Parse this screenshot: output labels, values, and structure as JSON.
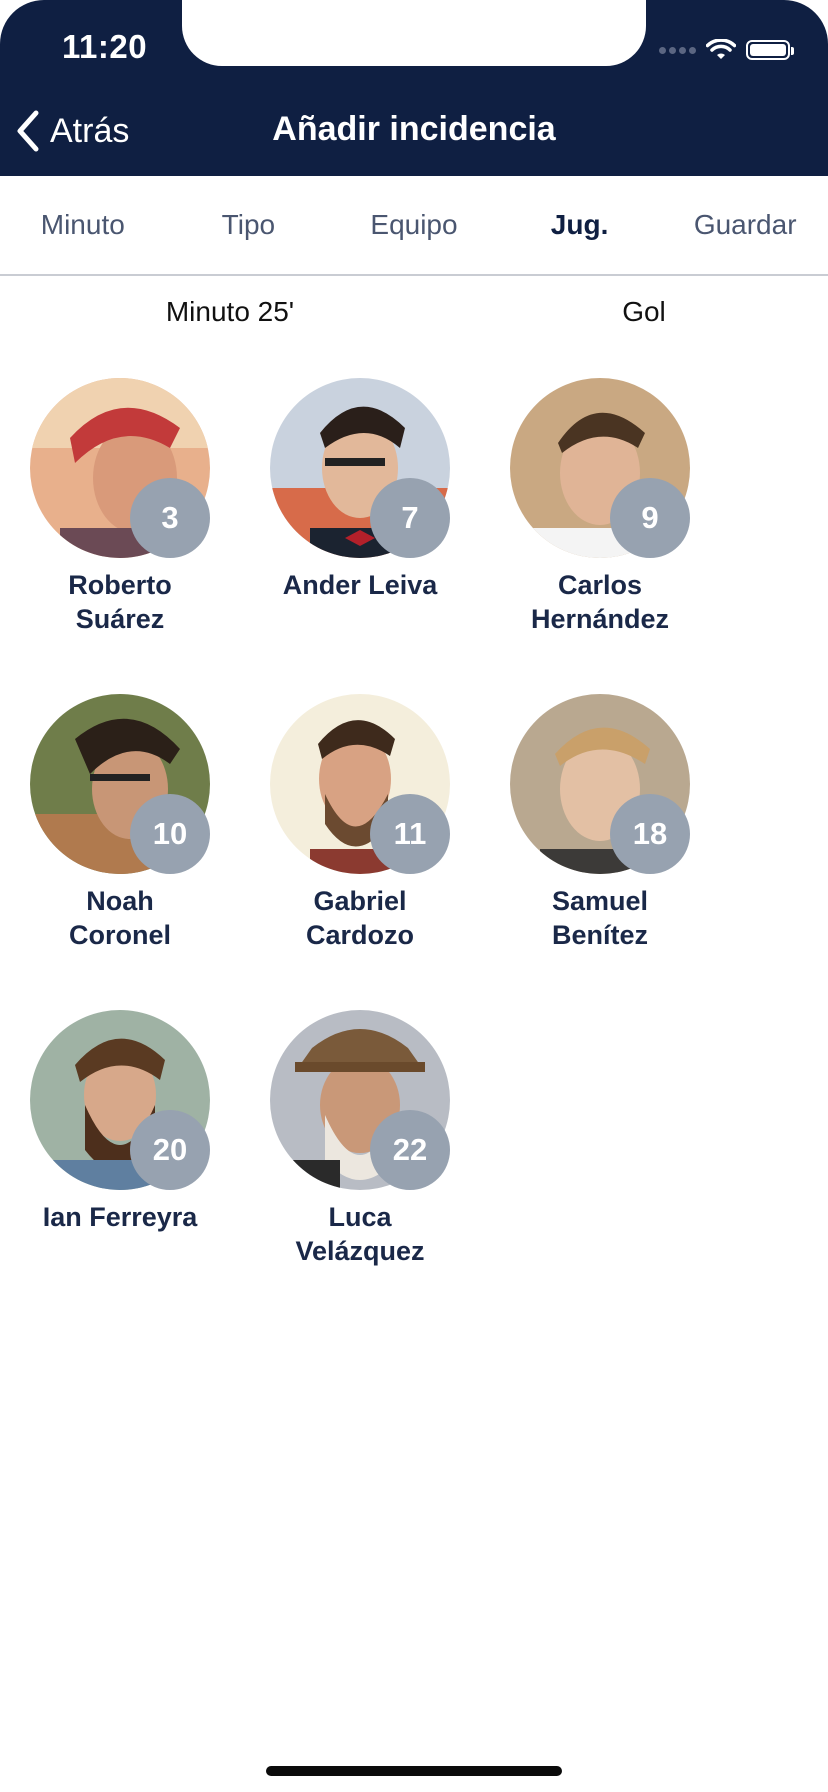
{
  "status": {
    "time": "11:20"
  },
  "nav": {
    "back_label": "Atrás",
    "title": "Añadir incidencia"
  },
  "tabs": [
    {
      "label": "Minuto",
      "active": false
    },
    {
      "label": "Tipo",
      "active": false
    },
    {
      "label": "Equipo",
      "active": false
    },
    {
      "label": "Jug.",
      "active": true
    },
    {
      "label": "Guardar",
      "active": false
    }
  ],
  "summary": {
    "minute": "Minuto 25'",
    "type": "Gol"
  },
  "players": [
    {
      "number": "3",
      "name": "Roberto Suárez",
      "line1": "Roberto",
      "line2": "Suárez",
      "avatar": "person-photo-red-cap"
    },
    {
      "number": "7",
      "name": "Ander Leiva",
      "line1": "Ander Leiva",
      "line2": "",
      "avatar": "person-photo-glasses-bowtie"
    },
    {
      "number": "9",
      "name": "Carlos Hernández",
      "line1": "Carlos",
      "line2": "Hernández",
      "avatar": "person-photo-young"
    },
    {
      "number": "10",
      "name": "Noah Coronel",
      "line1": "Noah",
      "line2": "Coronel",
      "avatar": "person-photo-pipe"
    },
    {
      "number": "11",
      "name": "Gabriel Cardozo",
      "line1": "Gabriel",
      "line2": "Cardozo",
      "avatar": "person-photo-beard"
    },
    {
      "number": "18",
      "name": "Samuel Benítez",
      "line1": "Samuel",
      "line2": "Benítez",
      "avatar": "person-photo-blond"
    },
    {
      "number": "20",
      "name": "Ian Ferreyra",
      "line1": "Ian Ferreyra",
      "line2": "",
      "avatar": "person-photo-long-beard"
    },
    {
      "number": "22",
      "name": "Luca Velázquez",
      "line1": "Luca",
      "line2": "Velázquez",
      "avatar": "person-photo-old-man-hat"
    }
  ],
  "colors": {
    "header_bg": "#0f1f42",
    "badge_bg": "#97a2b0",
    "name_text": "#1a2848"
  }
}
